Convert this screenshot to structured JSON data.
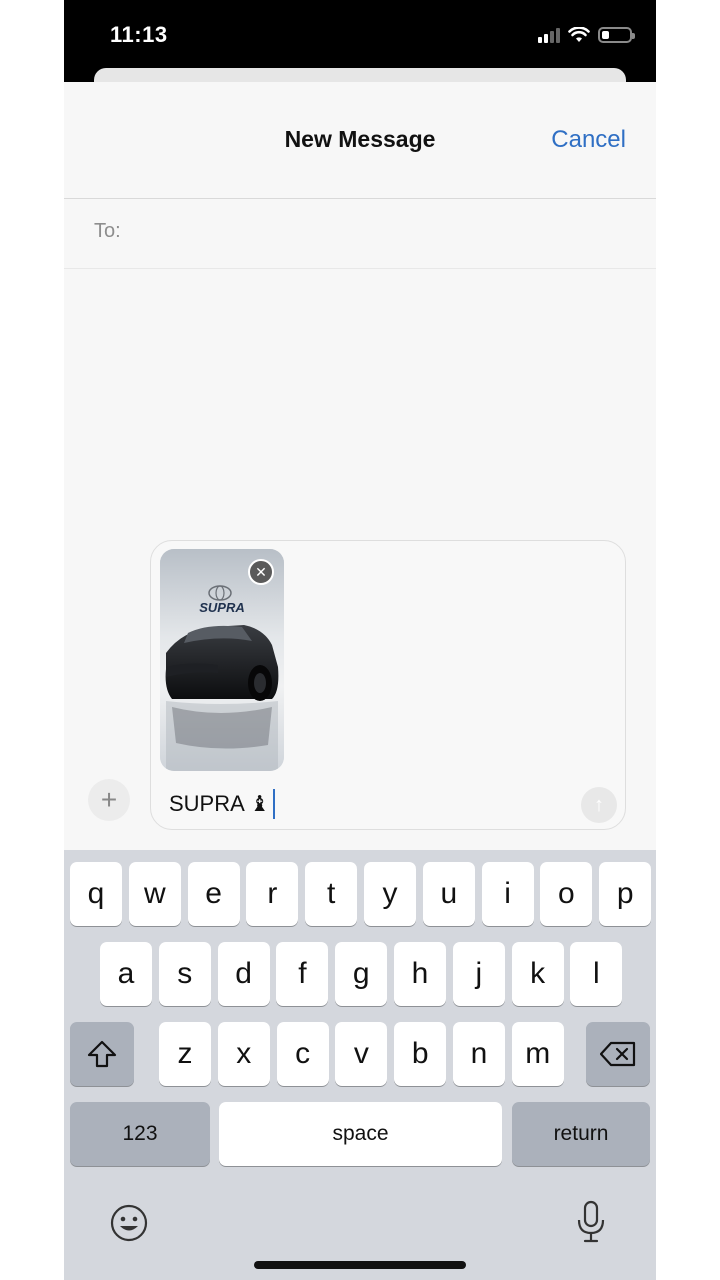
{
  "status_bar": {
    "time": "11:13"
  },
  "header": {
    "title": "New Message",
    "cancel_label": "Cancel"
  },
  "recipient": {
    "label": "To:",
    "value": ""
  },
  "compose": {
    "attachment_logo_text": "SUPRA",
    "text": "SUPRA ♝"
  },
  "keyboard": {
    "row1": [
      "q",
      "w",
      "e",
      "r",
      "t",
      "y",
      "u",
      "i",
      "o",
      "p"
    ],
    "row2": [
      "a",
      "s",
      "d",
      "f",
      "g",
      "h",
      "j",
      "k",
      "l"
    ],
    "row3": [
      "z",
      "x",
      "c",
      "v",
      "b",
      "n",
      "m"
    ],
    "numbers_label": "123",
    "space_label": "space",
    "return_label": "return"
  },
  "colors": {
    "accent": "#2f6fc4",
    "keyboard_bg": "#d4d7dd",
    "key_dark": "#abb1bb"
  },
  "icons": [
    "cellular-icon",
    "wifi-icon",
    "battery-icon",
    "close-icon",
    "plus-icon",
    "send-arrow-icon",
    "shift-icon",
    "delete-icon",
    "emoji-icon",
    "microphone-icon"
  ]
}
